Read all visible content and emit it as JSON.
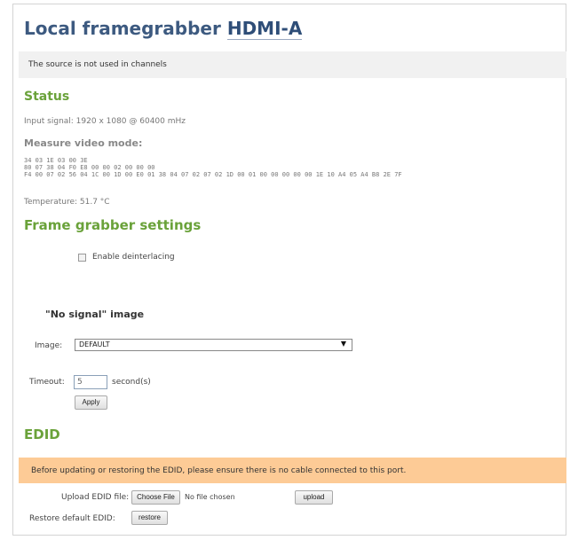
{
  "page": {
    "title_prefix": "Local framegrabber",
    "title_source": "HDMI-A",
    "notice": "The source is not used in channels"
  },
  "status": {
    "heading": "Status",
    "input_signal": "Input signal: 1920 x 1080 @ 60400 mHz",
    "measure_heading": "Measure video mode:",
    "hex_lines": [
      "34 03 1E 03 00 3E",
      "80 07 38 04 F0 E8 00 00 02 00 00 00",
      "F4 00 07 02 56 04 1C 00 1D 00 E0 01 38 04 07 02 07 02 1D 00 01 00 00 00 00 00 1E 10 A4 05 A4 B8 2E 7F"
    ],
    "temperature": "Temperature: 51.7 °C"
  },
  "framegrabber": {
    "heading": "Frame grabber settings",
    "deinterlace_label": "Enable deinterlacing",
    "deinterlace_checked": false
  },
  "no_signal": {
    "heading": "\"No signal\" image",
    "image_label": "Image:",
    "image_value": "DEFAULT",
    "timeout_label": "Timeout:",
    "timeout_value": "5",
    "timeout_unit": "second(s)",
    "apply_label": "Apply"
  },
  "edid": {
    "heading": "EDID",
    "warning": "Before updating or restoring the EDID, please ensure there is no cable connected to this port.",
    "upload_label": "Upload EDID file:",
    "choose_file_label": "Choose File",
    "no_file_text": "No file chosen",
    "upload_button": "upload",
    "restore_label": "Restore default EDID:",
    "restore_button": "restore"
  },
  "colors": {
    "title": "#3d5a80",
    "section": "#6aa23a",
    "notice_bg": "#f1f1f1",
    "warning_bg": "#fdcb96"
  }
}
